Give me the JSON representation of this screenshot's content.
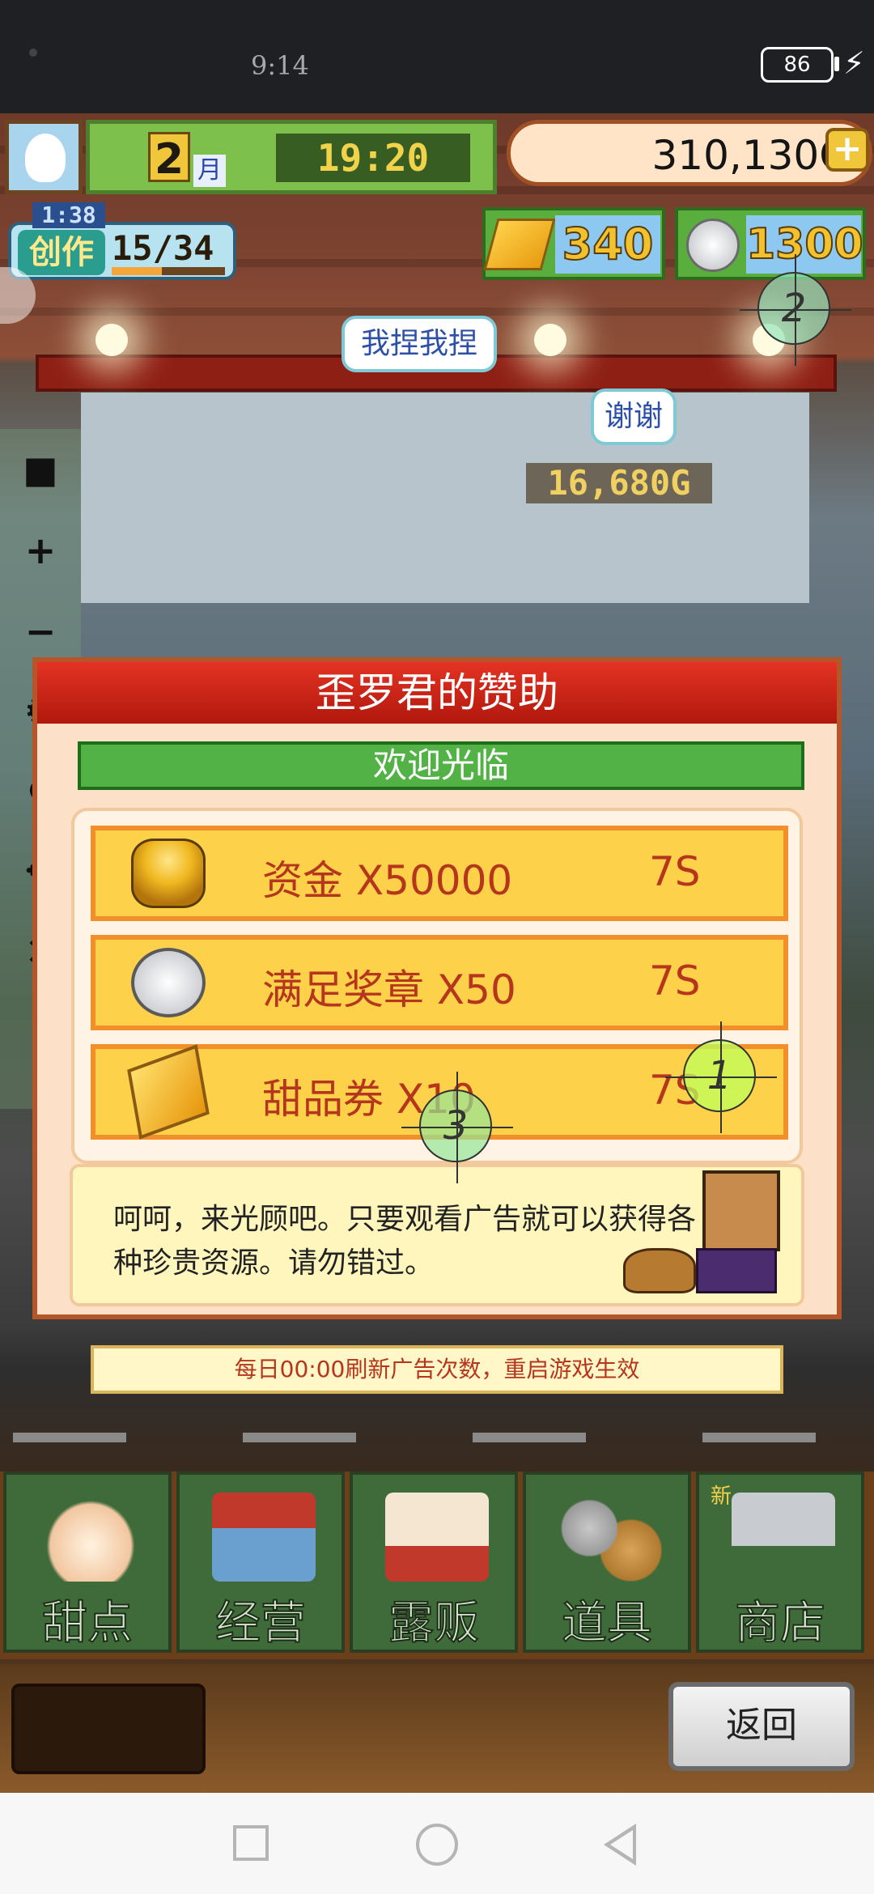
{
  "status_bar": {
    "time": "9:14",
    "battery": "86"
  },
  "hud": {
    "month_number": "2",
    "month_label": "月",
    "clock": "19:20",
    "gold": "310,130G",
    "gold_add": "+",
    "create_timer": "1:38",
    "create_label": "创作",
    "create_count": "15/34",
    "create_progress": 0.44,
    "tickets": "340",
    "medals": "1300"
  },
  "scene": {
    "bubble_1": "我捏我捏",
    "bubble_2": "谢谢",
    "price_popup": "16,680G"
  },
  "toolbar": {
    "items": [
      "stop",
      "zoom-in",
      "zoom-out",
      "settings",
      "hide",
      "move",
      "close"
    ]
  },
  "dialog": {
    "title": "歪罗君的赞助",
    "subtitle": "欢迎光临",
    "rewards": [
      {
        "name": "资金 X50000",
        "time": "7S",
        "icon": "gold-coins-icon"
      },
      {
        "name": "满足奖章 X50",
        "time": "7S",
        "icon": "silver-medal-icon"
      },
      {
        "name": "甜品券 X10",
        "time": "7S",
        "icon": "dessert-ticket-icon"
      }
    ],
    "info_text": "呵呵，来光顾吧。只要观看广告就可以获得各种珍贵资源。请勿错过。"
  },
  "notice": "每日00:00刷新广告次数，重启游戏生效",
  "menu": {
    "items": [
      {
        "label": "甜点",
        "icon": "cake-icon"
      },
      {
        "label": "经营",
        "icon": "shop-icon"
      },
      {
        "label": "露贩",
        "icon": "food-truck-icon"
      },
      {
        "label": "道具",
        "icon": "items-bag-icon"
      },
      {
        "label": "商店",
        "icon": "shopping-cart-icon"
      }
    ],
    "new_badge": "新"
  },
  "back_button": "返回",
  "markers": {
    "m1": "1",
    "m2": "2",
    "m3": "3"
  },
  "colors": {
    "dialog_header": "#d3271a",
    "reward_bg": "#fdd24a",
    "reward_text": "#b5361c",
    "subtitle_bg": "#52b246"
  }
}
